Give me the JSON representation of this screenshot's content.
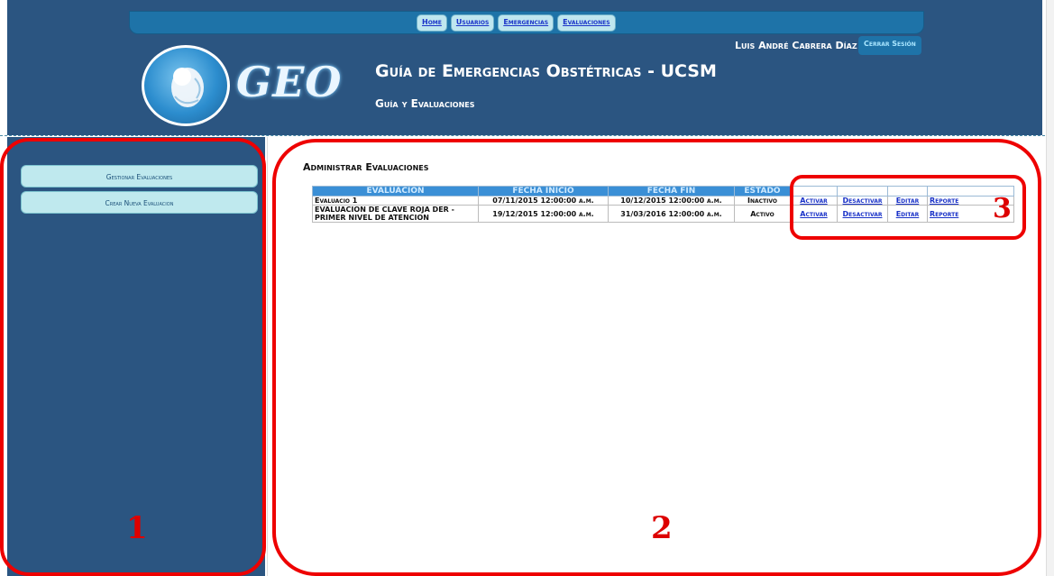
{
  "nav": {
    "links": [
      "Home",
      "Usuarios",
      "Emergencias",
      "Evaluaciones"
    ]
  },
  "user": {
    "name": "Luis André Cabrera Díaz",
    "logout_label": "Cerrar Sesión"
  },
  "brand": {
    "logo_text": "GEO",
    "title": "Guía de Emergencias Obstétricas - UCSM",
    "subtitle": "Guía y Evaluaciones"
  },
  "sidebar": {
    "items": [
      {
        "label": "Gestionar Evaluaciones"
      },
      {
        "label": "Crear Nueva Evaluacion"
      }
    ]
  },
  "main": {
    "title": "Administrar Evaluaciones",
    "table": {
      "headers": [
        "EVALUACION",
        "FECHA INICIO",
        "FECHA FIN",
        "ESTADO",
        "",
        "",
        "",
        ""
      ],
      "rows": [
        {
          "evaluacion": "Evaluacio 1",
          "fecha_inicio": "07/11/2015 12:00:00 a.m.",
          "fecha_fin": "10/12/2015 12:00:00 a.m.",
          "estado": "Inactivo",
          "actions": [
            "Activar",
            "Desactivar",
            "Editar",
            "Reporte"
          ]
        },
        {
          "evaluacion": "EVALUACION DE CLAVE ROJA DER - PRIMER NIVEL DE ATENCION",
          "fecha_inicio": "19/12/2015 12:00:00 a.m.",
          "fecha_fin": "31/03/2016 12:00:00 a.m.",
          "estado": "Activo",
          "actions": [
            "Activar",
            "Desactivar",
            "Editar",
            "Reporte"
          ]
        }
      ]
    }
  },
  "annotations": [
    "1",
    "2",
    "3"
  ],
  "colors": {
    "header_bg": "#2b5581",
    "nav_bar": "#1e73a8",
    "annotation_red": "#ee0000",
    "table_header": "#3a8fd6"
  }
}
